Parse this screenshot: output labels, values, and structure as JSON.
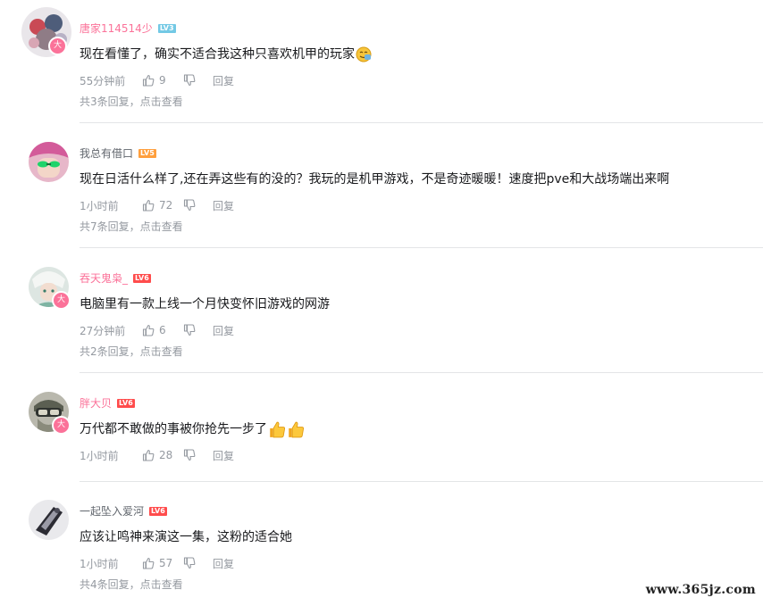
{
  "colors": {
    "vip_name": "#fb7299",
    "normal_name": "#61666d",
    "meta": "#9499a0",
    "divider": "#e3e5e7",
    "level_3": "#73c9e5",
    "level_5": "#ff9f3d",
    "level_6": "#ff4c4c"
  },
  "vip_badge_label": "大",
  "comments": [
    {
      "username": "唐家114514少",
      "level": "LV3",
      "content": "现在看懂了，确实不适合我这种只喜欢机甲的玩家",
      "emoji": "face-emoji",
      "time": "55分钟前",
      "likes": "9",
      "reply_label": "回复",
      "sub_replies": "共3条回复，点击查看"
    },
    {
      "username": "我总有借口",
      "level": "LV5",
      "content": "现在日活什么样了,还在弄这些有的没的？我玩的是机甲游戏，不是奇迹暖暖！速度把pve和大战场端出来啊",
      "time": "1小时前",
      "likes": "72",
      "reply_label": "回复",
      "sub_replies": "共7条回复，点击查看"
    },
    {
      "username": "吞天鬼枭_",
      "level": "LV6",
      "content": "电脑里有一款上线一个月快变怀旧游戏的网游",
      "time": "27分钟前",
      "likes": "6",
      "reply_label": "回复",
      "sub_replies": "共2条回复，点击查看"
    },
    {
      "username": "胖大贝",
      "level": "LV6",
      "content": "万代都不敢做的事被你抢先一步了",
      "emoji": "thumbs-up-emoji",
      "time": "1小时前",
      "likes": "28",
      "reply_label": "回复"
    },
    {
      "username": "一起坠入爱河",
      "level": "LV6",
      "content": "应该让鸣神来演这一集，这粉的适合她",
      "time": "1小时前",
      "likes": "57",
      "reply_label": "回复",
      "sub_replies": "共4条回复，点击查看"
    }
  ],
  "watermark": "www.365jz.com"
}
